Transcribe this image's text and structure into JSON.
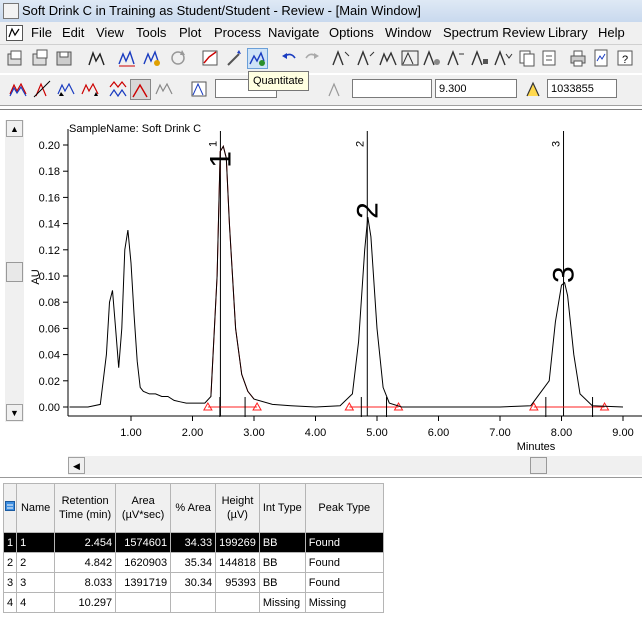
{
  "window": {
    "title": "Soft Drink C in Training as Student/Student - Review - [Main Window]"
  },
  "menu": {
    "items": [
      "File",
      "Edit",
      "View",
      "Tools",
      "Plot",
      "Process",
      "Navigate",
      "Options",
      "Window",
      "Spectrum Review",
      "Library",
      "Help"
    ]
  },
  "toolbar2": {
    "field_value": "9.300",
    "field_value2": "1033855"
  },
  "tooltip": "Quantitate",
  "chart_data": {
    "type": "line",
    "title": "SampleName: Soft Drink C",
    "xlabel": "Minutes",
    "ylabel": "AU",
    "xlim": [
      0.0,
      9.0
    ],
    "ylim": [
      -0.005,
      0.205
    ],
    "x_ticks": [
      "1.00",
      "2.00",
      "3.00",
      "4.00",
      "5.00",
      "6.00",
      "7.00",
      "8.00",
      "9.00"
    ],
    "y_ticks": [
      "0.00",
      "0.02",
      "0.04",
      "0.06",
      "0.08",
      "0.10",
      "0.12",
      "0.14",
      "0.16",
      "0.18",
      "0.20"
    ],
    "series": [
      {
        "x": [
          0.0,
          0.3,
          0.5,
          0.6,
          0.65,
          0.7,
          0.75,
          0.8,
          0.85,
          0.9,
          0.95,
          1.0,
          1.05,
          1.1,
          1.15,
          1.2,
          1.3,
          1.4,
          1.5,
          1.6,
          1.7,
          1.8,
          1.9,
          2.0,
          2.1,
          2.2,
          2.3,
          2.4,
          2.45,
          2.5,
          2.55,
          2.6,
          2.7,
          2.8,
          2.9,
          3.0,
          3.3,
          3.6,
          4.0,
          4.4,
          4.6,
          4.7,
          4.8,
          4.85,
          4.9,
          5.0,
          5.1,
          5.2,
          5.4,
          6.0,
          7.0,
          7.5,
          7.8,
          7.9,
          8.0,
          8.05,
          8.1,
          8.2,
          8.3,
          8.5,
          9.0
        ],
        "y": [
          0.0,
          0.0,
          0.002,
          0.04,
          0.08,
          0.089,
          0.06,
          0.03,
          0.06,
          0.12,
          0.135,
          0.11,
          0.07,
          0.035,
          0.015,
          0.012,
          0.01,
          0.01,
          0.008,
          0.008,
          0.005,
          0.004,
          0.003,
          0.003,
          0.003,
          0.003,
          0.008,
          0.1,
          0.195,
          0.199,
          0.19,
          0.14,
          0.06,
          0.025,
          0.012,
          0.006,
          0.002,
          0.001,
          0.0,
          0.001,
          0.01,
          0.05,
          0.12,
          0.145,
          0.13,
          0.06,
          0.015,
          0.003,
          0.0,
          0.0,
          0.0,
          0.001,
          0.02,
          0.065,
          0.093,
          0.095,
          0.085,
          0.04,
          0.01,
          0.001,
          0.0
        ]
      }
    ],
    "peak_markers": [
      {
        "label": "1",
        "x": 2.454
      },
      {
        "label": "2",
        "x": 4.842
      },
      {
        "label": "3",
        "x": 8.033
      }
    ],
    "peak_labels": [
      {
        "label": "1",
        "x": 2.454,
        "y": 0.189
      },
      {
        "label": "2",
        "x": 4.842,
        "y": 0.15
      },
      {
        "label": "3",
        "x": 8.033,
        "y": 0.101
      }
    ]
  },
  "results": {
    "headers": [
      "Name",
      "Retention Time (min)",
      "Area (µV*sec)",
      "% Area",
      "Height (µV)",
      "Int Type",
      "Peak Type"
    ],
    "rows": [
      {
        "index": "1",
        "name": "1",
        "rt": "2.454",
        "area": "1574601",
        "pct_area": "34.33",
        "height": "199269",
        "int_type": "BB",
        "peak_type": "Found"
      },
      {
        "index": "2",
        "name": "2",
        "rt": "4.842",
        "area": "1620903",
        "pct_area": "35.34",
        "height": "144818",
        "int_type": "BB",
        "peak_type": "Found"
      },
      {
        "index": "3",
        "name": "3",
        "rt": "8.033",
        "area": "1391719",
        "pct_area": "30.34",
        "height": "95393",
        "int_type": "BB",
        "peak_type": "Found"
      },
      {
        "index": "4",
        "name": "4",
        "rt": "10.297",
        "area": "",
        "pct_area": "",
        "height": "",
        "int_type": "Missing",
        "peak_type": "Missing"
      }
    ]
  }
}
